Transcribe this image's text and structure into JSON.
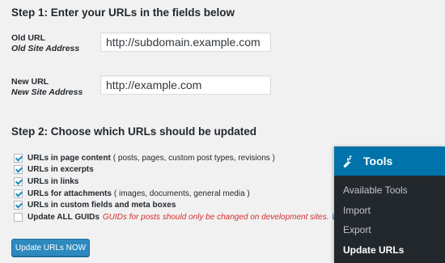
{
  "step1": {
    "heading": "Step 1: Enter your URLs in the fields below",
    "old_url": {
      "label": "Old URL",
      "sublabel": "Old Site Address",
      "value": "http://subdomain.example.com"
    },
    "new_url": {
      "label": "New URL",
      "sublabel": "New Site Address",
      "value": "http://example.com"
    }
  },
  "step2": {
    "heading": "Step 2: Choose which URLs should be updated",
    "options": [
      {
        "label": "URLs in page content",
        "extra": "( posts, pages, custom post types, revisions )",
        "checked": true
      },
      {
        "label": "URLs in excerpts",
        "extra": "",
        "checked": true
      },
      {
        "label": "URLs in links",
        "extra": "",
        "checked": true
      },
      {
        "label": "URLs for attachments",
        "extra": "( images, documents, general media )",
        "checked": true
      },
      {
        "label": "URLs in custom fields and meta boxes",
        "extra": "",
        "checked": true
      },
      {
        "label": "Update ALL GUIDs",
        "extra": "",
        "warning": "GUIDs for posts should only be changed on development sites.",
        "link": "Le",
        "checked": false
      }
    ]
  },
  "submit_label": "Update URLs NOW",
  "tools_menu": {
    "title": "Tools",
    "icon": "wrench-icon",
    "items": [
      "Available Tools",
      "Import",
      "Export",
      "Update URLs"
    ],
    "current": "Update URLs"
  },
  "colors": {
    "accent": "#0073aa",
    "button": "#2e89bf",
    "menu_bg": "#23282d",
    "warning": "#d52e2e"
  }
}
